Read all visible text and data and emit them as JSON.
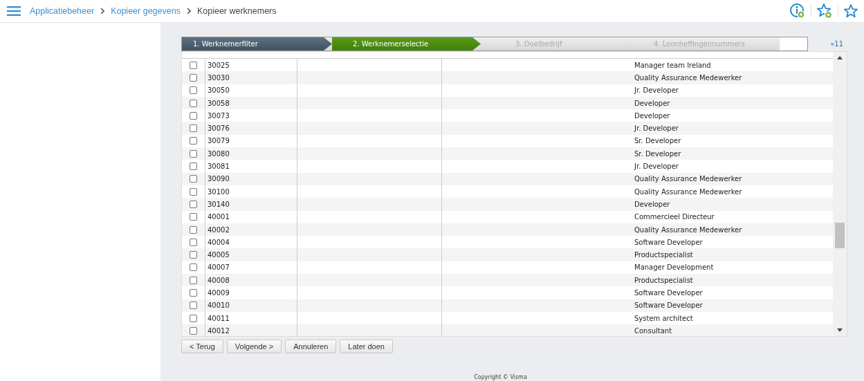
{
  "breadcrumb": [
    {
      "label": "Applicatiebeheer",
      "kind": "link"
    },
    {
      "label": "Kopieer gegevens",
      "kind": "link"
    },
    {
      "label": "Kopieer werknemers",
      "kind": "current"
    }
  ],
  "wizard": {
    "steps": [
      {
        "label": "1. Werknemerfilter",
        "completed": true,
        "selected": false
      },
      {
        "label": "2. Werknemerselectie",
        "completed": false,
        "selected": true
      },
      {
        "label": "3. Doelbedrijf",
        "completed": false,
        "selected": false
      },
      {
        "label": "4. Loonheffingennummers",
        "completed": false,
        "selected": false
      }
    ],
    "more": "»11"
  },
  "table": {
    "rows": [
      {
        "number": "30025",
        "function": "Manager team Ireland",
        "checked": false
      },
      {
        "number": "30030",
        "function": "Quality Assurance Medewerker",
        "checked": false
      },
      {
        "number": "30050",
        "function": "Jr. Developer",
        "checked": false
      },
      {
        "number": "30058",
        "function": "Developer",
        "checked": false
      },
      {
        "number": "30073",
        "function": "Developer",
        "checked": false
      },
      {
        "number": "30076",
        "function": "Jr. Developer",
        "checked": false
      },
      {
        "number": "30079",
        "function": "Sr. Developer",
        "checked": false
      },
      {
        "number": "30080",
        "function": "Sr. Developer",
        "checked": false
      },
      {
        "number": "30081",
        "function": "Jr. Developer",
        "checked": false
      },
      {
        "number": "30090",
        "function": "Quality Assurance Medewerker",
        "checked": false
      },
      {
        "number": "30100",
        "function": "Quality Assurance Medewerker",
        "checked": false
      },
      {
        "number": "30140",
        "function": "Developer",
        "checked": false
      },
      {
        "number": "40001",
        "function": "Commercieel Directeur",
        "checked": false
      },
      {
        "number": "40002",
        "function": "Quality Assurance Medewerker",
        "checked": false
      },
      {
        "number": "40004",
        "function": "Software Developer",
        "checked": false
      },
      {
        "number": "40005",
        "function": "Productspecialist",
        "checked": false
      },
      {
        "number": "40007",
        "function": "Manager Development",
        "checked": false
      },
      {
        "number": "40008",
        "function": "Productspecialist",
        "checked": false
      },
      {
        "number": "40009",
        "function": "Software Developer",
        "checked": false
      },
      {
        "number": "40010",
        "function": "Software Developer",
        "checked": false
      },
      {
        "number": "40011",
        "function": "System architect",
        "checked": false
      },
      {
        "number": "40012",
        "function": "Consultant",
        "checked": false
      }
    ]
  },
  "buttons": [
    "< Terug",
    "Volgende >",
    "Annuleren",
    "Later doen"
  ],
  "footer": "Copyright © Visma"
}
